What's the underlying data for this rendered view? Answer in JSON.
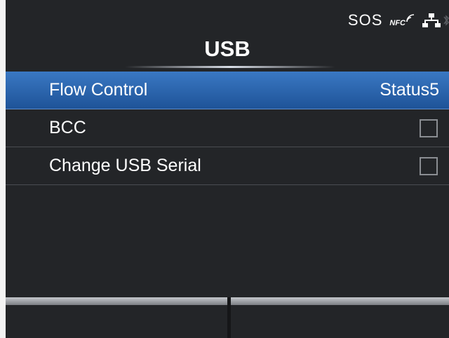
{
  "status_bar": {
    "sos": "SOS",
    "nfc": "NFC",
    "icons": [
      "nfc-icon",
      "network-icon",
      "bluetooth-icon"
    ]
  },
  "header": {
    "title": "USB"
  },
  "menu": {
    "items": [
      {
        "label": "Flow Control",
        "value": "Status5",
        "type": "value",
        "selected": true
      },
      {
        "label": "BCC",
        "type": "checkbox",
        "checked": false
      },
      {
        "label": "Change USB Serial",
        "type": "checkbox",
        "checked": false
      }
    ]
  },
  "softkeys": {
    "left_label": "",
    "right_label": ""
  },
  "colors": {
    "background": "#232528",
    "selection": "#2a66b0",
    "text": "#ffffff"
  }
}
